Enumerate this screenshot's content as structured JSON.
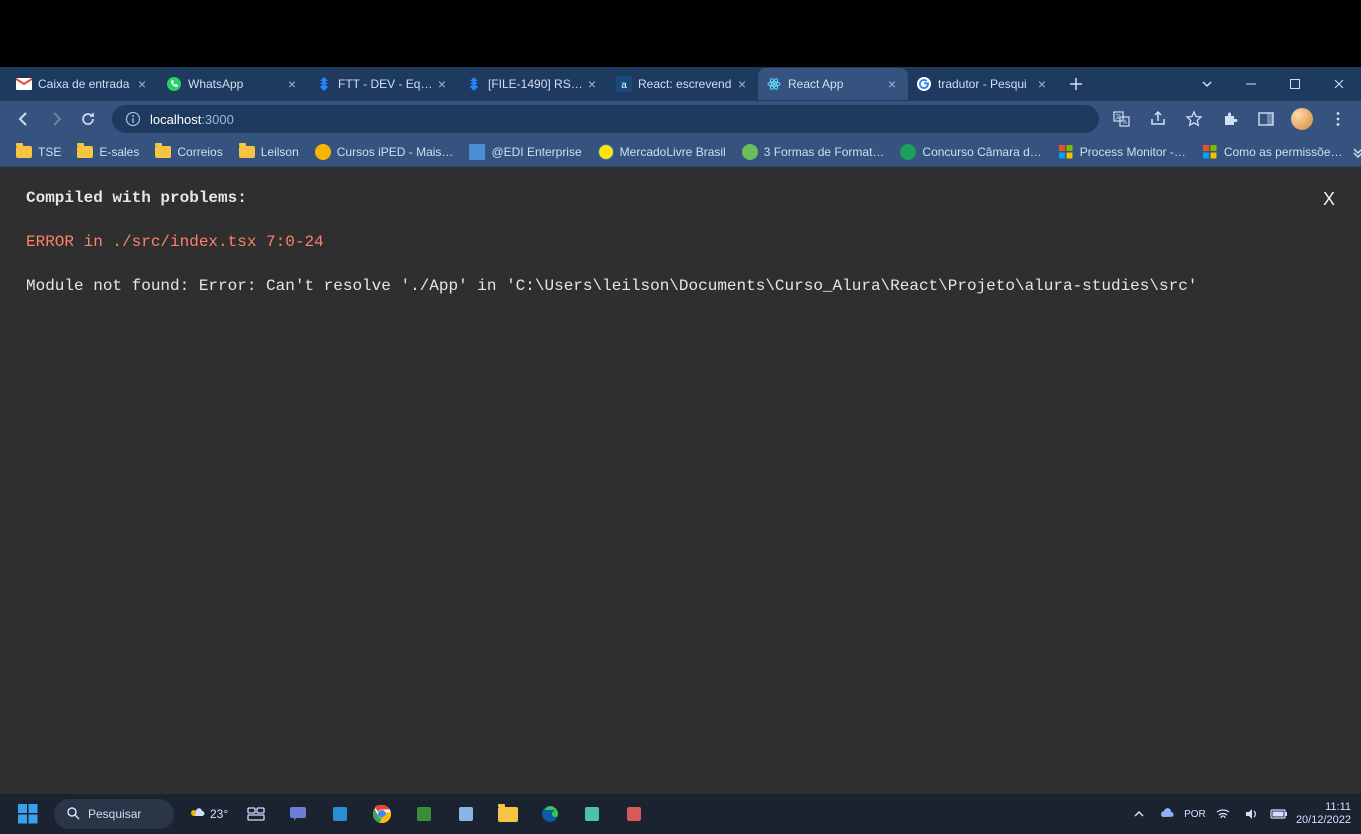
{
  "tabs": [
    {
      "label": "Caixa de entrada",
      "icon": "gmail-icon"
    },
    {
      "label": "WhatsApp",
      "icon": "whatsapp-icon"
    },
    {
      "label": "FTT - DEV - Equip",
      "icon": "jira-icon"
    },
    {
      "label": "[FILE-1490] RSA -",
      "icon": "jira-icon"
    },
    {
      "label": "React: escrevend",
      "icon": "alura-icon"
    },
    {
      "label": "React App",
      "icon": "react-icon",
      "active": true
    },
    {
      "label": "tradutor - Pesqui",
      "icon": "google-icon"
    }
  ],
  "address": {
    "host": "localhost",
    "port": ":3000"
  },
  "bookmarks": [
    {
      "label": "TSE",
      "icon": "folder"
    },
    {
      "label": "E-sales",
      "icon": "folder"
    },
    {
      "label": "Correios",
      "icon": "folder"
    },
    {
      "label": "Leilson",
      "icon": "folder"
    },
    {
      "label": "Cursos iPED - Mais…",
      "icon": "iped"
    },
    {
      "label": "@EDI Enterprise",
      "icon": "edi"
    },
    {
      "label": "MercadoLivre Brasil",
      "icon": "meli"
    },
    {
      "label": "3 Formas de Format…",
      "icon": "wikihow"
    },
    {
      "label": "Concurso Câmara d…",
      "icon": "concurso"
    },
    {
      "label": "Process Monitor -…",
      "icon": "ms"
    },
    {
      "label": "Como as permissõe…",
      "icon": "ms"
    }
  ],
  "page": {
    "title": "Compiled with problems:",
    "error": "ERROR in ./src/index.tsx 7:0-24",
    "body": "Module not found: Error: Can't resolve './App' in 'C:\\Users\\leilson\\Documents\\Curso_Alura\\React\\Projeto\\alura-studies\\src'",
    "close": "X"
  },
  "taskbar": {
    "search_placeholder": "Pesquisar",
    "weather": "23°",
    "time": "11:11",
    "date": "20/12/2022"
  }
}
